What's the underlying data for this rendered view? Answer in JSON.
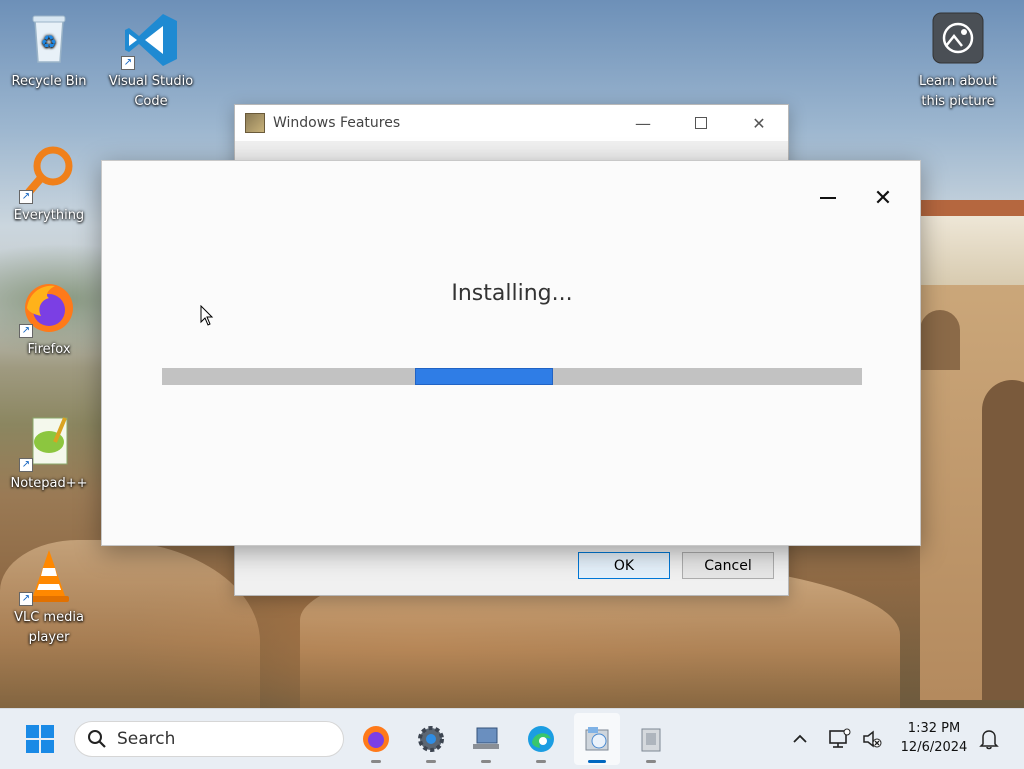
{
  "desktop_icons": [
    {
      "label": "Recycle Bin",
      "icon": "recycle-bin-icon"
    },
    {
      "label_line1": "Visual Studio",
      "label_line2": "Code",
      "icon": "vscode-icon"
    },
    {
      "label": "Everything",
      "icon": "everything-search-icon"
    },
    {
      "label": "Firefox",
      "icon": "firefox-icon"
    },
    {
      "label": "Notepad++",
      "icon": "notepadpp-icon"
    },
    {
      "label_line1": "VLC media",
      "label_line2": "player",
      "icon": "vlc-icon"
    },
    {
      "label_line1": "Learn about",
      "label_line2": "this picture",
      "icon": "camera-icon"
    }
  ],
  "windows_features": {
    "title": "Windows Features",
    "ok_label": "OK",
    "cancel_label": "Cancel"
  },
  "install_dialog": {
    "status_text": "Installing...",
    "progress_indeterminate": true
  },
  "taskbar": {
    "search_placeholder": "Search",
    "time": "1:32 PM",
    "date": "12/6/2024",
    "apps": [
      "firefox",
      "settings",
      "network-computer",
      "edge",
      "installer",
      "package"
    ]
  },
  "colors": {
    "accent": "#0078d7",
    "progress_fill": "#2f7de6",
    "progress_track": "#c2c2c2"
  }
}
